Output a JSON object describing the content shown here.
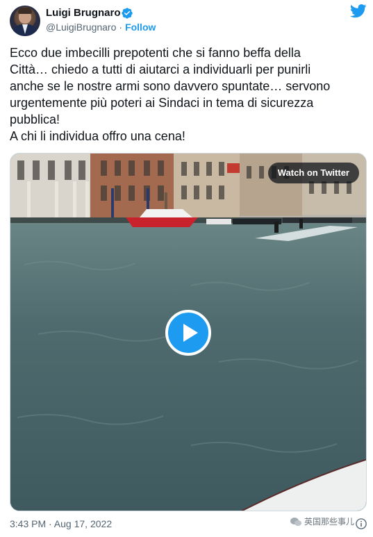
{
  "author": {
    "name": "Luigi Brugnaro",
    "handle": "@LuigiBrugnaro",
    "separator": "·",
    "follow_label": "Follow"
  },
  "tweet": {
    "text": "Ecco due imbecilli prepotenti che si fanno beffa della\nCittà… chiedo a tutti di aiutarci a individuarli per punirli\nanche se le nostre armi sono davvero spuntate… servono\nurgentemente più poteri ai Sindaci in tema di sicurezza\npubblica!\nA chi li individua offro una cena!",
    "timestamp": "3:43 PM · Aug 17, 2022"
  },
  "media": {
    "watch_label": "Watch on Twitter"
  },
  "watermark": {
    "text": "英国那些事儿"
  },
  "colors": {
    "accent": "#1d9bf0",
    "text_primary": "#0f1419",
    "text_secondary": "#536471"
  },
  "icons": {
    "brand": "twitter-bird-icon",
    "verified": "verified-badge-icon",
    "play": "play-icon",
    "info": "info-icon"
  }
}
